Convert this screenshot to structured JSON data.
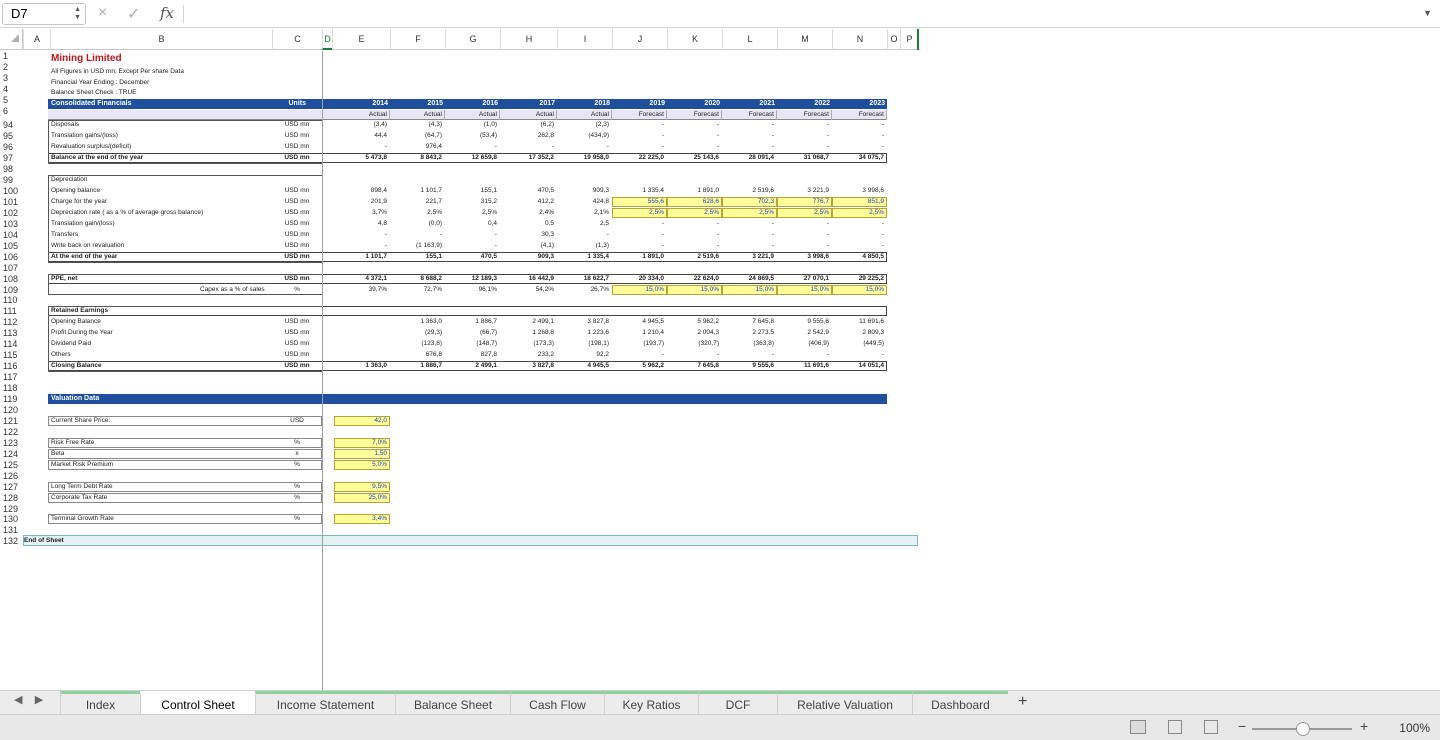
{
  "formula": {
    "cell_ref": "D7",
    "cancel_icon": "×",
    "enter_icon": "✓",
    "fx_label": "fx"
  },
  "columns": [
    "A",
    "B",
    "C",
    "D",
    "E",
    "F",
    "G",
    "H",
    "I",
    "J",
    "K",
    "L",
    "M",
    "N",
    "O",
    "P"
  ],
  "header": {
    "title": "Mining Limited",
    "line2": "All Figures in USD mn; Except Per share Data",
    "line3": "Financial Year Ending : December",
    "line4": "Balance Sheet Check : TRUE",
    "consolidated": "Consolidated Financials",
    "units": "Units",
    "years": [
      "2014",
      "2015",
      "2016",
      "2017",
      "2018",
      "2019",
      "2020",
      "2021",
      "2022",
      "2023"
    ],
    "status": [
      "Actual",
      "Actual",
      "Actual",
      "Actual",
      "Actual",
      "Forecast",
      "Forecast",
      "Forecast",
      "Forecast",
      "Forecast"
    ]
  },
  "rows": [
    {
      "n": "94",
      "label": "Disposals",
      "unit": "USD mn",
      "vals": [
        "(3,4)",
        "(4,3)",
        "(1,0)",
        "(6,2)",
        "(2,3)",
        "-",
        "-",
        "-",
        "-",
        "-"
      ]
    },
    {
      "n": "95",
      "label": "Translation gains/(loss)",
      "unit": "USD mn",
      "vals": [
        "44,4",
        "(64,7)",
        "(53,4)",
        "262,8",
        "(434,9)",
        "-",
        "-",
        "-",
        "-",
        "-"
      ]
    },
    {
      "n": "96",
      "label": "Revaluation surplus/(deficit)",
      "unit": "USD mn",
      "vals": [
        "-",
        "976,4",
        "-",
        "-",
        "-",
        "-",
        "-",
        "-",
        "-",
        "-"
      ]
    },
    {
      "n": "97",
      "label": "Balance at the end of the year",
      "unit": "USD mn",
      "bold": true,
      "vals": [
        "5 473,8",
        "8 843,2",
        "12 659,8",
        "17 352,2",
        "19 958,0",
        "22 225,0",
        "25 143,6",
        "28 091,4",
        "31 068,7",
        "34 075,7"
      ]
    },
    {
      "n": "98",
      "label": "",
      "unit": "",
      "vals": []
    },
    {
      "n": "99",
      "label": "Depreciation",
      "unit": "",
      "vals": []
    },
    {
      "n": "100",
      "label": "Opening balance",
      "unit": "USD mn",
      "vals": [
        "898,4",
        "1 101,7",
        "155,1",
        "470,5",
        "909,3",
        "1 335,4",
        "1 891,0",
        "2 519,6",
        "3 221,9",
        "3 998,6"
      ]
    },
    {
      "n": "101",
      "label": "Charge for the year",
      "unit": "USD mn",
      "vals": [
        "201,9",
        "221,7",
        "315,2",
        "412,2",
        "424,8",
        "555,6",
        "628,6",
        "702,3",
        "776,7",
        "851,9"
      ],
      "yellowFrom": 5
    },
    {
      "n": "102",
      "label": "Depreciation rate ( as a % of average gross balance)",
      "unit": "USD mn",
      "vals": [
        "3,7%",
        "2,5%",
        "2,5%",
        "2,4%",
        "2,1%",
        "2,5%",
        "2,5%",
        "2,5%",
        "2,5%",
        "2,5%"
      ],
      "yellowFrom": 5
    },
    {
      "n": "103",
      "label": "Translation gain/(loss)",
      "unit": "USD mn",
      "vals": [
        "4,8",
        "(0,0)",
        "0,4",
        "0,5",
        "2,5",
        "-",
        "-",
        "-",
        "-",
        "-"
      ]
    },
    {
      "n": "104",
      "label": "Transfers",
      "unit": "USD mn",
      "vals": [
        "-",
        "-",
        "-",
        "30,3",
        "-",
        "-",
        "-",
        "-",
        "-",
        "-"
      ]
    },
    {
      "n": "105",
      "label": "Write back on revaluation",
      "unit": "USD mn",
      "vals": [
        "-",
        "(1 163,9)",
        "-",
        "(4,1)",
        "(1,3)",
        "-",
        "-",
        "-",
        "-",
        "-"
      ]
    },
    {
      "n": "106",
      "label": "At the end of the year",
      "unit": "USD mn",
      "bold": true,
      "vals": [
        "1 101,7",
        "155,1",
        "470,5",
        "909,3",
        "1 335,4",
        "1 891,0",
        "2 519,6",
        "3 221,9",
        "3 998,6",
        "4 850,5"
      ]
    },
    {
      "n": "107",
      "label": "",
      "unit": "",
      "vals": []
    },
    {
      "n": "108",
      "label": "PPE, net",
      "unit": "USD mn",
      "bold": true,
      "vals": [
        "4 372,1",
        "8 688,2",
        "12 189,3",
        "16 442,9",
        "18 622,7",
        "20 334,0",
        "22 624,0",
        "24 869,5",
        "27 070,1",
        "29 225,2"
      ]
    },
    {
      "n": "109",
      "label": "Capex as a % of sales",
      "unit": "%",
      "indent": true,
      "vals": [
        "39,7%",
        "72,7%",
        "96,1%",
        "54,2%",
        "26,7%",
        "15,0%",
        "15,0%",
        "15,0%",
        "15,0%",
        "15,0%"
      ],
      "yellowFrom": 5
    },
    {
      "n": "110",
      "label": "",
      "unit": "",
      "vals": []
    },
    {
      "n": "111",
      "label": "Retained Earnings",
      "unit": "",
      "bold": true,
      "vals": []
    },
    {
      "n": "112",
      "label": "Opening Balance",
      "unit": "USD mn",
      "vals": [
        "",
        "1 363,0",
        "1 886,7",
        "2 499,1",
        "3 827,8",
        "4 945,5",
        "5 962,2",
        "7 645,8",
        "9 555,6",
        "11 691,6"
      ]
    },
    {
      "n": "113",
      "label": "Profit During the Year",
      "unit": "USD mn",
      "vals": [
        "",
        "(29,3)",
        "(66,7)",
        "1 268,8",
        "1 223,6",
        "1 210,4",
        "2 004,3",
        "2 273,5",
        "2 542,9",
        "2 809,3"
      ]
    },
    {
      "n": "114",
      "label": "Dividend Paid",
      "unit": "USD mn",
      "vals": [
        "",
        "(123,8)",
        "(148,7)",
        "(173,3)",
        "(198,1)",
        "(193,7)",
        "(320,7)",
        "(363,8)",
        "(406,9)",
        "(449,5)"
      ]
    },
    {
      "n": "115",
      "label": "Others",
      "unit": "USD mn",
      "vals": [
        "",
        "676,8",
        "827,8",
        "233,2",
        "92,2",
        "-",
        "-",
        "-",
        "-",
        "-"
      ]
    },
    {
      "n": "116",
      "label": "Closing Balance",
      "unit": "USD mn",
      "bold": true,
      "vals": [
        "1 363,0",
        "1 886,7",
        "2 499,1",
        "3 827,8",
        "4 945,5",
        "5 962,2",
        "7 645,8",
        "9 555,6",
        "11 691,6",
        "14 051,4"
      ]
    },
    {
      "n": "117",
      "label": "",
      "unit": "",
      "vals": []
    },
    {
      "n": "118",
      "label": "",
      "unit": "",
      "vals": []
    },
    {
      "n": "119",
      "label": "Valuation Data",
      "unit": "",
      "header": true,
      "vals": []
    },
    {
      "n": "120",
      "label": "",
      "unit": "",
      "vals": []
    },
    {
      "n": "121",
      "label": "Current Share Price:",
      "unit": "USD",
      "input": "42,0"
    },
    {
      "n": "122",
      "label": "",
      "unit": "",
      "vals": []
    },
    {
      "n": "123",
      "label": "Risk Free Rate",
      "unit": "%",
      "input": "7,0%"
    },
    {
      "n": "124",
      "label": "Beta",
      "unit": "x",
      "input": "1,50"
    },
    {
      "n": "125",
      "label": "Market Risk Premium",
      "unit": "%",
      "input": "5,0%"
    },
    {
      "n": "126",
      "label": "",
      "unit": "",
      "vals": []
    },
    {
      "n": "127",
      "label": "Long Term Debt Rate",
      "unit": "%",
      "input": "9,5%"
    },
    {
      "n": "128",
      "label": "Corporate Tax Rate",
      "unit": "%",
      "input": "25,0%"
    },
    {
      "n": "129",
      "label": "",
      "unit": "",
      "vals": []
    },
    {
      "n": "130",
      "label": "Terminal Growth Rate",
      "unit": "%",
      "input": "3,4%"
    },
    {
      "n": "131",
      "label": "",
      "unit": "",
      "vals": []
    },
    {
      "n": "132",
      "label": "End of Sheet",
      "unit": "",
      "end": true
    }
  ],
  "tabs": [
    "Index",
    "Control Sheet",
    "Income Statement",
    "Balance Sheet",
    "Cash Flow",
    "Key Ratios",
    "DCF",
    "Relative Valuation",
    "Dashboard"
  ],
  "active_tab": "Control Sheet",
  "add_sheet": "+",
  "zoom": "100%",
  "nav": {
    "prev": "◀",
    "next": "▶"
  }
}
